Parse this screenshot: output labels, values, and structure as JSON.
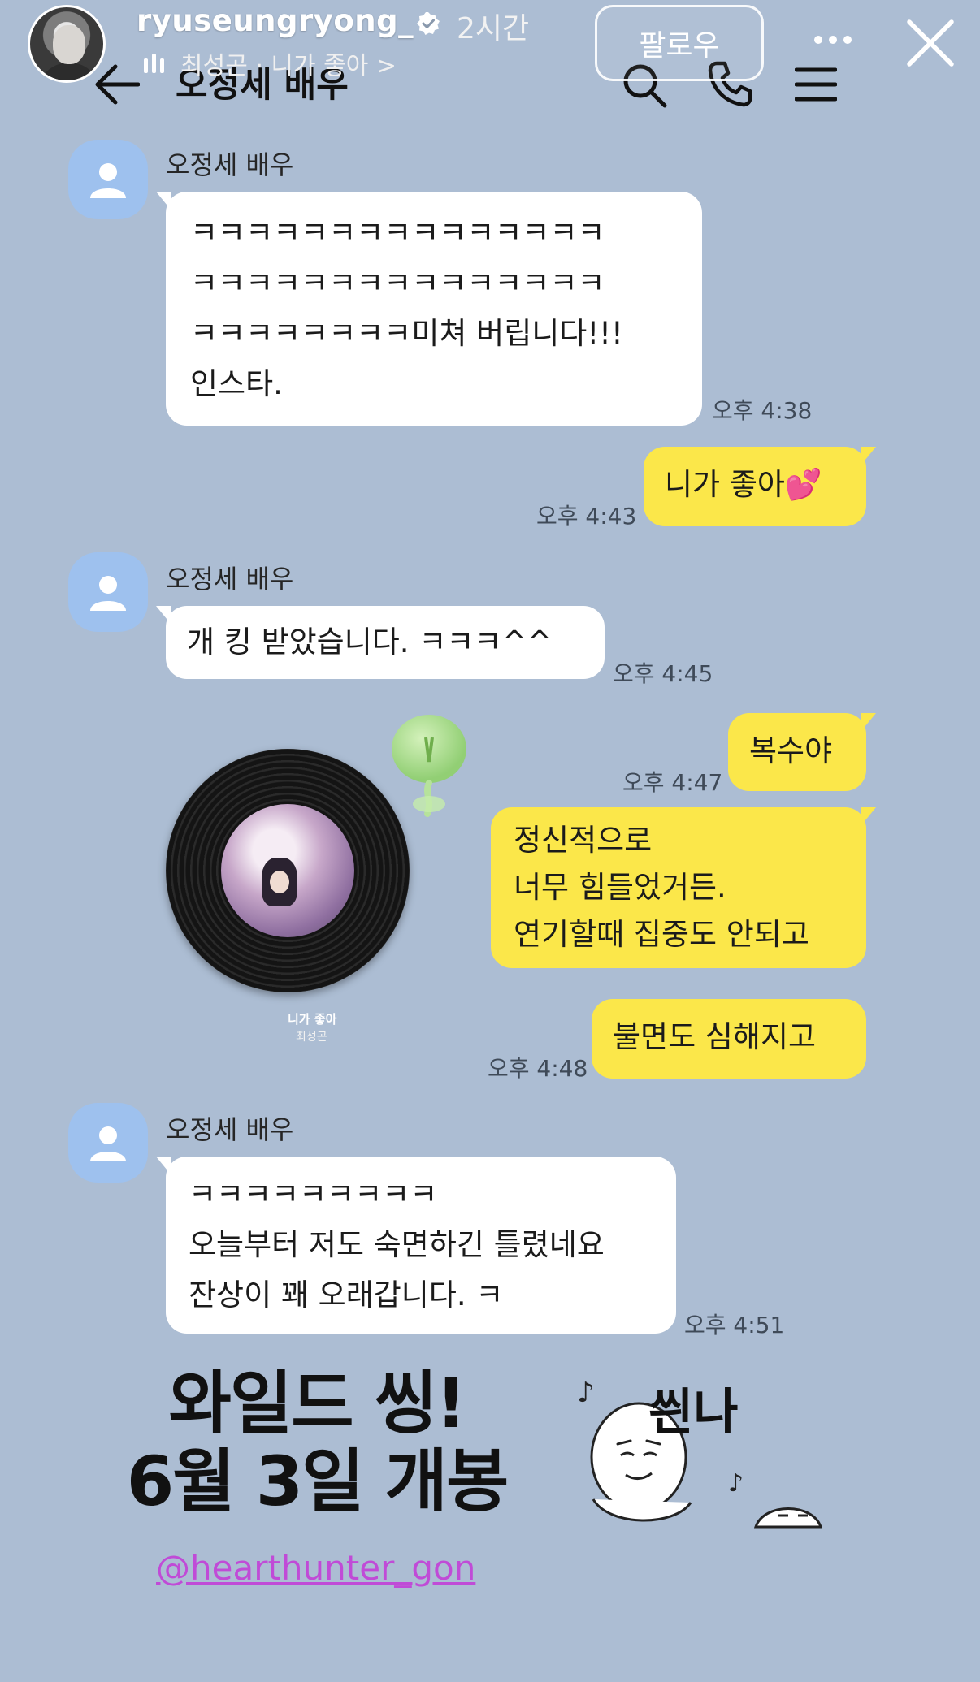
{
  "story": {
    "username": "ryuseungryong_",
    "time": "2시간",
    "music": "최성곤 · 니가 좋아 >",
    "follow_label": "팔로우"
  },
  "chat": {
    "title": "오정세 배우",
    "messages": [
      {
        "sender": "오정세 배우",
        "text": "ㅋㅋㅋㅋㅋㅋㅋㅋㅋㅋㅋㅋㅋㅋㅋ\nㅋㅋㅋㅋㅋㅋㅋㅋㅋㅋㅋㅋㅋㅋㅋ\nㅋㅋㅋㅋㅋㅋㅋㅋ미쳐 버립니다!!!\n인스타.",
        "time": "오후 4:38"
      },
      {
        "text": "니가 좋아💕",
        "time": "오후 4:43"
      },
      {
        "sender": "오정세 배우",
        "text": "개 킹 받았습니다. ㅋㅋㅋ^^",
        "time": "오후 4:45"
      },
      {
        "text": "복수야",
        "time": "오후 4:47"
      },
      {
        "text": "정신적으로\n너무 힘들었거든.\n연기할때 집중도 안되고"
      },
      {
        "text": "불면도 심해지고",
        "time": "오후 4:48"
      },
      {
        "sender": "오정세 배우",
        "text": "ㅋㅋㅋㅋㅋㅋㅋㅋㅋ\n오늘부터 저도 숙면하긴 틀렸네요\n잔상이 꽤 오래갑니다. ㅋ",
        "time": "오후 4:51"
      }
    ]
  },
  "music_sticker": {
    "title": "니가 좋아",
    "artist": "최성곤"
  },
  "overlay": {
    "line1": "와일드 씽!",
    "line2": "6월 3일 개봉",
    "mention": "@hearthunter_gon",
    "sticker_text": "씐나"
  }
}
